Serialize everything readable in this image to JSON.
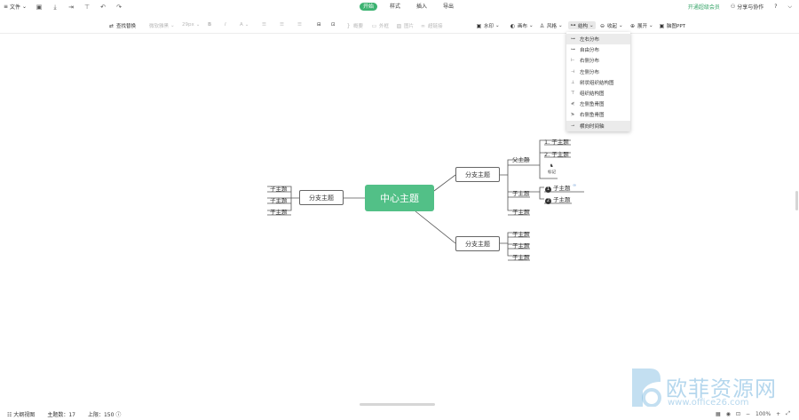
{
  "top": {
    "file_label": "文件",
    "tabs": [
      {
        "label": "开始",
        "active": true
      },
      {
        "label": "样式",
        "active": false
      },
      {
        "label": "插入",
        "active": false
      },
      {
        "label": "导出",
        "active": false
      }
    ],
    "vip_label": "开通超级会员",
    "share_label": "分享与协作",
    "help": "?"
  },
  "toolbar": {
    "find_replace": "查找替换",
    "font_family": "微软雅黑",
    "font_size": "29px",
    "bold": "B",
    "italic": "I",
    "font_color": "A",
    "summary": "概要",
    "outline": "外框",
    "image": "图片",
    "hyperlink": "超链接",
    "watermark": "水印",
    "canvas": "画布",
    "style": "风格",
    "structure": "结构",
    "collapse": "收起",
    "expand": "展开",
    "ppt": "脑图PPT"
  },
  "structure_menu": [
    {
      "label": "左右分布",
      "icon": "左右",
      "selected": true
    },
    {
      "label": "自由分布",
      "icon": "自由",
      "selected": false
    },
    {
      "label": "右侧分布",
      "icon": "右侧",
      "selected": false
    },
    {
      "label": "左侧分布",
      "icon": "左侧",
      "selected": false
    },
    {
      "label": "树状组织结构图",
      "icon": "树状",
      "selected": false
    },
    {
      "label": "组织结构图",
      "icon": "组织",
      "selected": false
    },
    {
      "label": "左侧鱼骨图",
      "icon": "左鱼",
      "selected": false
    },
    {
      "label": "右侧鱼骨图",
      "icon": "右鱼",
      "selected": false
    },
    {
      "label": "横向时间轴",
      "icon": "时间",
      "selected": false
    }
  ],
  "mindmap": {
    "center": "中心主题",
    "left_branch": "分支主题",
    "left_leaves": [
      "子主题",
      "子主题",
      "子主题"
    ],
    "right_top_branch": "分支主题",
    "parent_topic": "父主题",
    "numbered_leaves": [
      "1. 子主题",
      "2. 子主题"
    ],
    "sticker_label": "标记",
    "sub_a": "子主题",
    "badge_leaves": [
      {
        "n": "1",
        "label": "子主题"
      },
      {
        "n": "2",
        "label": "子主题"
      }
    ],
    "sub_b": "子主题",
    "right_bottom_branch": "分支主题",
    "right_bottom_leaves": [
      "子主题",
      "子主题",
      "子主题"
    ]
  },
  "status": {
    "outline_view": "大纲视图",
    "topic_count": "主题数：17",
    "limit": "上限：150",
    "zoom": "100%"
  },
  "watermark": {
    "text": "欧菲资源网",
    "url": "www.office26.com"
  }
}
